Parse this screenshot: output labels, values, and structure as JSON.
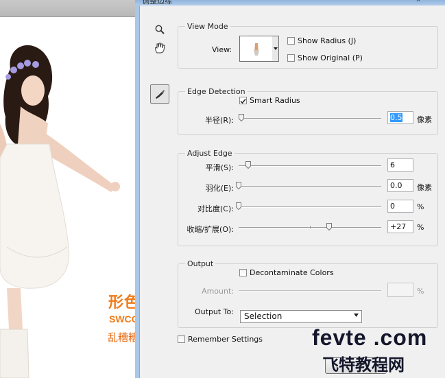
{
  "dialog": {
    "title": "调整边缘",
    "close_label": "x"
  },
  "tools": {
    "zoom_icon": "zoom-magnifier",
    "hand_icon": "hand",
    "refine_icon": "refine-radius-brush"
  },
  "view_mode": {
    "legend": "View Mode",
    "view_label": "View:",
    "show_radius": {
      "label": "Show Radius (J)",
      "checked": false
    },
    "show_original": {
      "label": "Show Original (P)",
      "checked": false
    }
  },
  "edge_detection": {
    "legend": "Edge Detection",
    "smart_radius": {
      "label": "Smart Radius",
      "checked": true
    },
    "radius": {
      "label": "半径(R):",
      "value": "0.5",
      "unit": "像素",
      "slider_fraction": 0.0
    }
  },
  "adjust_edge": {
    "legend": "Adjust Edge",
    "smooth": {
      "label": "平滑(S):",
      "value": "6",
      "unit": "",
      "slider_fraction": 0.06
    },
    "feather": {
      "label": "羽化(E):",
      "value": "0.0",
      "unit": "像素",
      "slider_fraction": 0.0
    },
    "contrast": {
      "label": "对比度(C):",
      "value": "0",
      "unit": "%",
      "slider_fraction": 0.0
    },
    "shift_edge": {
      "label": "收缩/扩展(O):",
      "value": "+27",
      "unit": "%",
      "slider_fraction": 0.635
    }
  },
  "output": {
    "legend": "Output",
    "decontaminate": {
      "label": "Decontaminate Colors",
      "checked": false
    },
    "amount": {
      "label": "Amount:",
      "value": "",
      "unit": "%",
      "enabled": false
    },
    "output_to": {
      "label": "Output To:",
      "value": "Selection"
    }
  },
  "remember_settings": {
    "label": "Remember Settings",
    "checked": false
  },
  "watermarks": {
    "logo_cn": "形色主义",
    "logo_site": "SWCOOL.COM",
    "caption_cn": "乱糟糟的季节",
    "fevte": "fevte .com",
    "fevte_cn": "飞特教程网"
  },
  "colors": {
    "dialog_frame": "#a9c7e8",
    "client_bg": "#f0f0f0",
    "selection_highlight": "#3399ff",
    "watermark_orange": "#f07b1a"
  }
}
